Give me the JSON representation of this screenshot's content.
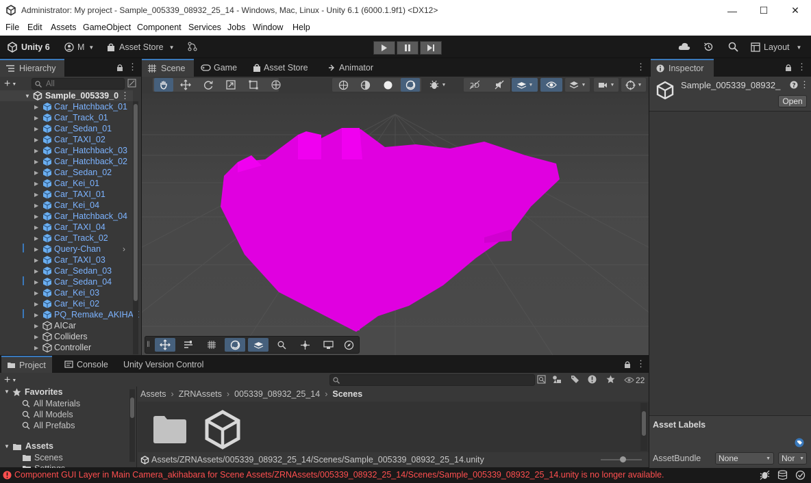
{
  "window": {
    "title": "Administrator: My project - Sample_005339_08932_25_14 - Windows, Mac, Linux - Unity 6.1 (6000.1.9f1) <DX12>",
    "controls": {
      "minimize": "—",
      "maximize": "☐",
      "close": "✕"
    }
  },
  "menu": [
    "File",
    "Edit",
    "Assets",
    "GameObject",
    "Component",
    "Services",
    "Jobs",
    "Window",
    "Help"
  ],
  "toolbar": {
    "unity_label": "Unity 6",
    "account": "M",
    "asset_store": "Asset Store",
    "layout": "Layout"
  },
  "hierarchy": {
    "tab": "Hierarchy",
    "search_placeholder": "All",
    "root": "Sample_005339_0",
    "items": [
      {
        "label": "Car_Hatchback_01",
        "style": "blue"
      },
      {
        "label": "Car_Track_01",
        "style": "blue"
      },
      {
        "label": "Car_Sedan_01",
        "style": "blue"
      },
      {
        "label": "Car_TAXI_02",
        "style": "blue"
      },
      {
        "label": "Car_Hatchback_03",
        "style": "blue"
      },
      {
        "label": "Car_Hatchback_02",
        "style": "blue"
      },
      {
        "label": "Car_Sedan_02",
        "style": "blue"
      },
      {
        "label": "Car_Kei_01",
        "style": "blue"
      },
      {
        "label": "Car_TAXI_01",
        "style": "blue"
      },
      {
        "label": "Car_Kei_04",
        "style": "blue"
      },
      {
        "label": "Car_Hatchback_04",
        "style": "blue"
      },
      {
        "label": "Car_TAXI_04",
        "style": "blue"
      },
      {
        "label": "Car_Track_02",
        "style": "blue"
      },
      {
        "label": "Query-Chan",
        "style": "blue"
      },
      {
        "label": "Car_TAXI_03",
        "style": "blue"
      },
      {
        "label": "Car_Sedan_03",
        "style": "blue"
      },
      {
        "label": "Car_Sedan_04",
        "style": "blue"
      },
      {
        "label": "Car_Kei_03",
        "style": "blue"
      },
      {
        "label": "Car_Kei_02",
        "style": "blue"
      },
      {
        "label": "PQ_Remake_AKIHAE",
        "style": "blue"
      },
      {
        "label": "AICar",
        "style": "gray"
      },
      {
        "label": "Colliders",
        "style": "gray"
      },
      {
        "label": "Controller",
        "style": "gray"
      }
    ]
  },
  "scene_tabs": [
    "Scene",
    "Game",
    "Asset Store",
    "Animator"
  ],
  "inspector": {
    "tab": "Inspector",
    "object_name": "Sample_005339_08932_",
    "open_button": "Open",
    "asset_labels": "Asset Labels",
    "asset_bundle_label": "AssetBundle",
    "asset_bundle_value": "None",
    "asset_bundle_variant": "Nor"
  },
  "project": {
    "tabs": [
      "Project",
      "Console",
      "Unity Version Control"
    ],
    "favorites_label": "Favorites",
    "favorites": [
      "All Materials",
      "All Models",
      "All Prefabs"
    ],
    "assets_label": "Assets",
    "assets_children": [
      "Scenes",
      "Settings"
    ],
    "breadcrumb": [
      "Assets",
      "ZRNAssets",
      "005339_08932_25_14",
      "Scenes"
    ],
    "visible_count": "22",
    "footer_path": "Assets/ZRNAssets/005339_08932_25_14/Scenes/Sample_005339_08932_25_14.unity"
  },
  "status": {
    "message": "Component GUI Layer in Main Camera_akihabara for Scene Assets/ZRNAssets/005339_08932_25_14/Scenes/Sample_005339_08932_25_14.unity is no longer available.",
    "color": "#ff4f4f"
  },
  "colors": {
    "accent": "#3a79bb",
    "prefab_blue": "#7cb3ff",
    "magenta_mesh": "#e000e0"
  }
}
